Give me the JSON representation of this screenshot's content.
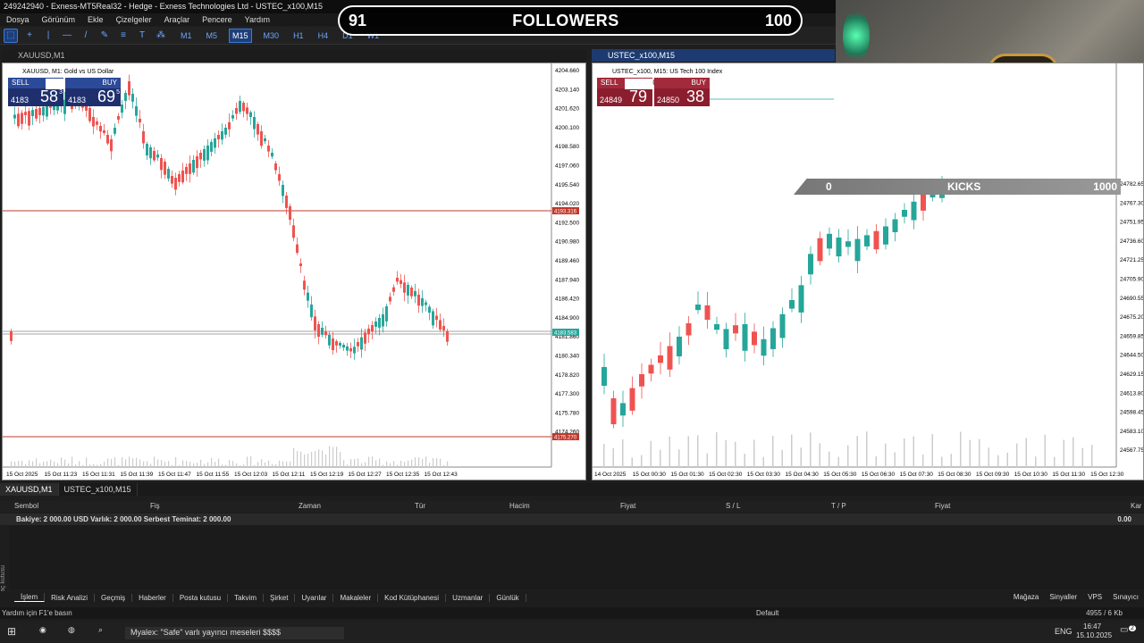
{
  "window": {
    "title": "249242940 - Exness-MT5Real32 - Hedge - Exness Technologies Ltd - USTEC_x100,M15"
  },
  "menu": [
    "Dosya",
    "Görünüm",
    "Ekle",
    "Çizelgeler",
    "Araçlar",
    "Pencere",
    "Yardım"
  ],
  "timeframes": [
    "M1",
    "M5",
    "M15",
    "M30",
    "H1",
    "H4",
    "D1",
    "W1"
  ],
  "active_timeframe": "M15",
  "overlay": {
    "followers_current": "91",
    "followers_label": "FOLLOWERS",
    "followers_goal": "100",
    "kicks_current": "0",
    "kicks_label": "KICKS",
    "kicks_goal": "1000"
  },
  "chart_left": {
    "tab_title": "XAUUSD,M1",
    "header": "XAUUSD, M1:  Gold vs US Dollar",
    "sell_label": "SELL",
    "buy_label": "BUY",
    "lot": "0.01",
    "sell_price_prefix": "4183",
    "sell_price_big": "58",
    "sell_price_sup": "3",
    "buy_price_prefix": "4183",
    "buy_price_big": "69",
    "buy_price_sup": "5",
    "price_labels": [
      "4204.660",
      "4203.140",
      "4201.620",
      "4200.100",
      "4198.580",
      "4197.060",
      "4195.540",
      "4194.020",
      "4192.500",
      "4190.980",
      "4189.460",
      "4187.940",
      "4186.420",
      "4184.900",
      "4181.860",
      "4180.340",
      "4178.820",
      "4177.300",
      "4175.780",
      "4174.260"
    ],
    "line_marker_top": "4193.316",
    "line_marker_current": "4183.583",
    "line_marker_bottom": "4175.270",
    "time_labels": [
      "15 Oct 2025",
      "15 Oct 11:23",
      "15 Oct 11:31",
      "15 Oct 11:39",
      "15 Oct 11:47",
      "15 Oct 11:55",
      "15 Oct 12:03",
      "15 Oct 12:11",
      "15 Oct 12:19",
      "15 Oct 12:27",
      "15 Oct 12:35",
      "15 Oct 12:43"
    ]
  },
  "chart_right": {
    "tab_title": "USTEC_x100,M15",
    "header": "USTEC_x100, M15:  US Tech 100 Index",
    "sell_label": "SELL",
    "buy_label": "BUY",
    "lot": "0.01",
    "sell_price_prefix": "24849",
    "sell_price_big": "79",
    "buy_price_prefix": "24850",
    "buy_price_big": "38",
    "price_labels": [
      "24782.65",
      "24767.30",
      "24751.95",
      "24736.60",
      "24721.25",
      "24705.90",
      "24690.55",
      "24675.20",
      "24659.85",
      "24644.50",
      "24629.15",
      "24613.80",
      "24598.45",
      "24583.10",
      "24567.75"
    ],
    "time_labels": [
      "14 Oct 2025",
      "15 Oct 00:30",
      "15 Oct 01:30",
      "15 Oct 02:30",
      "15 Oct 03:30",
      "15 Oct 04:30",
      "15 Oct 05:30",
      "15 Oct 06:30",
      "15 Oct 07:30",
      "15 Oct 08:30",
      "15 Oct 09:30",
      "15 Oct 10:30",
      "15 Oct 11:30",
      "15 Oct 12:30"
    ]
  },
  "bottom_tabs": [
    "XAUUSD,M1",
    "USTEC_x100,M15"
  ],
  "terminal": {
    "columns": [
      "Sembol",
      "Fiş",
      "Zaman",
      "Tür",
      "Hacim",
      "Fiyat",
      "S / L",
      "T / P",
      "Fiyat",
      "Kar"
    ],
    "balance_row": "Bakiye: 2 000.00 USD  Varlık: 2 000.00  Serbest Teminat: 2 000.00",
    "balance_value": "0.00",
    "side_label": "Araç kutusu",
    "tabs": [
      "İşlem",
      "Risk Analizi",
      "Geçmiş",
      "Haberler",
      "Posta kutusu",
      "Takvim",
      "Şirket",
      "Uyarılar",
      "Makaleler",
      "Kod Kütüphanesi",
      "Uzmanlar",
      "Günlük"
    ],
    "right_links": [
      "Mağaza",
      "Sinyaller",
      "VPS",
      "Sınayıcı"
    ]
  },
  "status": {
    "help": "Yardım için F1'e basın",
    "profile": "Default",
    "traffic": "4955 / 6 Kb"
  },
  "taskbar": {
    "ticker": "Myalex: \"Safe\" varlı yayıncı meseleri $$$$",
    "lang": "ENG",
    "time": "16:47",
    "date": "15.10.2025",
    "notifications": "2"
  },
  "colors": {
    "bull": "#26a69a",
    "bear": "#ef5350",
    "sell_panel": "#1f2f6e",
    "ustec_panel": "#8b1e2e",
    "line_red": "#c0392b"
  }
}
